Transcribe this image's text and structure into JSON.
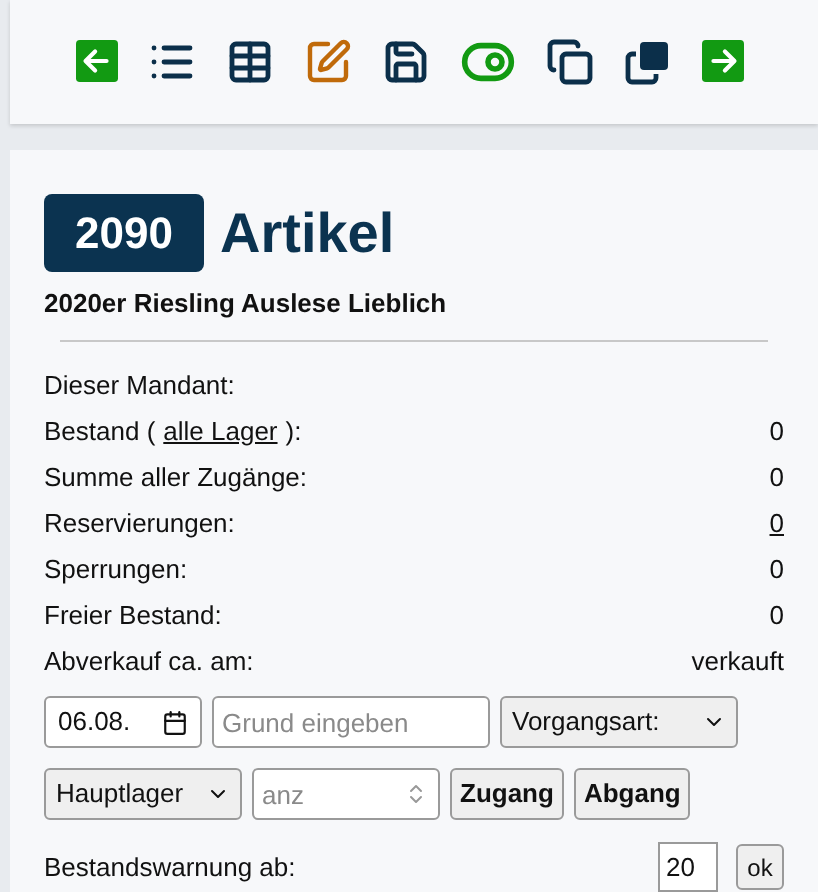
{
  "toolbar": [
    {
      "kind": "back"
    },
    {
      "kind": "list"
    },
    {
      "kind": "table"
    },
    {
      "kind": "edit"
    },
    {
      "kind": "save"
    },
    {
      "kind": "toggle"
    },
    {
      "kind": "copy"
    },
    {
      "kind": "duplicate"
    },
    {
      "kind": "forward"
    }
  ],
  "article": {
    "number": "2090",
    "heading": "Artikel",
    "name": "2020er Riesling Auslese Lieblich"
  },
  "stock_rows": [
    {
      "label": [
        {
          "text": "Dieser Mandant:",
          "link": false
        }
      ]
    },
    {
      "label": [
        {
          "text": "Bestand (",
          "link": false
        },
        {
          "text": "alle Lager",
          "link": true
        },
        {
          "text": "):",
          "link": false
        }
      ],
      "value": "0",
      "value_link": false
    },
    {
      "label": [
        {
          "text": "Summe aller Zugänge:",
          "link": false
        }
      ],
      "value": "0",
      "value_link": false
    },
    {
      "label": [
        {
          "text": "Reservierungen:",
          "link": false
        }
      ],
      "value": "0",
      "value_link": true
    },
    {
      "label": [
        {
          "text": "Sperrungen:",
          "link": false
        }
      ],
      "value": "0",
      "value_link": false
    },
    {
      "label": [
        {
          "text": "Freier Bestand:",
          "link": false
        }
      ],
      "value": "0",
      "value_link": false
    },
    {
      "label": [
        {
          "text": "Abverkauf ca. am:",
          "link": false
        }
      ],
      "value": "verkauft",
      "value_link": false
    }
  ],
  "booking": {
    "date": "06.08.",
    "reason_placeholder": "Grund eingeben",
    "type_select": "Vorgangsart:",
    "warehouse_select": "Hauptlager",
    "amount_placeholder": "anz",
    "buttons": [
      "Zugang",
      "Abgang"
    ]
  },
  "warning": {
    "label": "Bestandswarnung ab:",
    "value": "20",
    "button": "ok"
  }
}
